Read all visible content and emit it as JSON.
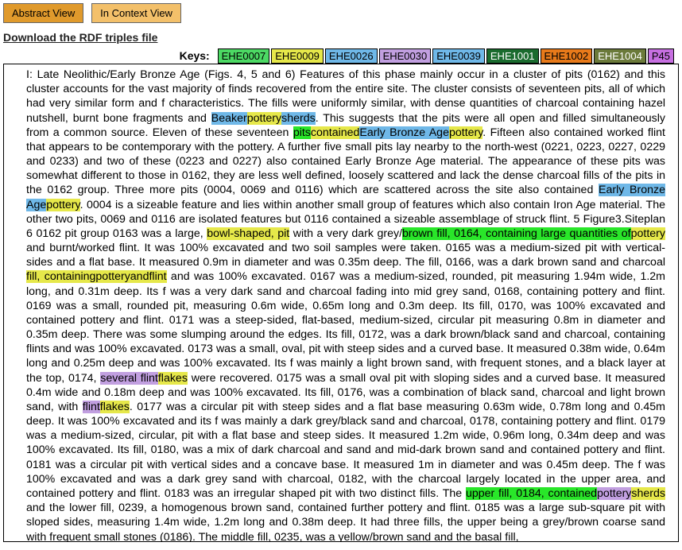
{
  "toolbar": {
    "abstract_btn": "Abstract View",
    "context_btn": "In Context View",
    "download_link": "Download the RDF triples file"
  },
  "keys": {
    "label": "Keys:",
    "items": [
      {
        "code": "EHE0007",
        "cls": "k7"
      },
      {
        "code": "EHE0009",
        "cls": "k9"
      },
      {
        "code": "EHE0026",
        "cls": "k26"
      },
      {
        "code": "EHE0030",
        "cls": "k30"
      },
      {
        "code": "EHE0039",
        "cls": "k39"
      },
      {
        "code": "EHE1001",
        "cls": "k1001"
      },
      {
        "code": "EHE1002",
        "cls": "k1002"
      },
      {
        "code": "EHE1004",
        "cls": "k1004"
      },
      {
        "code": "P45",
        "cls": "k45"
      }
    ]
  },
  "doc": {
    "t01": "I: Late Neolithic/Early Bronze Age (Figs. 4, 5 and 6) Features of this phase mainly occur in a cluster of pits (0162) and this cluster accounts for the vast majority of finds recovered from the entire site. The cluster consists of seventeen pits, all of which had very similar form and f characteristics. The fills were uniformly similar, with dense quantities of charcoal containing hazel nutshell, burnt bone fragments and ",
    "h01a": "Beaker",
    "h01b": "pottery",
    "h01c": "sherds",
    "t02": ". This suggests that the pits were all open and filled simultaneously from a common source. Eleven of these seventeen ",
    "h02a": "pits",
    "h02b": "contained",
    "h02c": "Early Bronze Age",
    "h02d": "pottery",
    "t03": ". Fifteen also contained worked flint that appears to be contemporary with the pottery. A further five small pits lay nearby to the north-west (0221, 0223, 0227, 0229 and 0233) and two of these (0223 and 0227) also contained Early Bronze Age material. The appearance of these pits was somewhat different to those in 0162, they are less well defined, loosely scattered and lack the dense charcoal fills of the pits in the 0162 group. Three more pits (0004, 0069 and 0116) which are scattered across the site also contained ",
    "h03a": "Early Bronze Age",
    "h03b": "pottery",
    "t04": ". 0004 is a sizeable feature and lies within another small group of features which also contain Iron Age material. The other two pits, 0069 and 0116 are isolated features but 0116 contained a sizeable assemblage of struck flint. 5 Figure3.Siteplan 6 0162 pit group 0163 was a large, ",
    "h04a": "bowl-shaped, pit",
    "t05": " with a very dark grey/",
    "h05a": "brown fill, 0164, containing large quantities of",
    "h05b": "pottery",
    "t06": " and burnt/worked flint. It was 100% excavated and two soil samples were taken. 0165 was a medium-sized pit with vertical-sides and a flat base. It measured 0.9m in diameter and was 0.35m deep. The fill, 0166, was a dark brown sand and charcoal ",
    "h06a": "fill, containing",
    "h06b": "pottery",
    "h06c": "and",
    "h06d": "flint",
    "t07": " and was 100% excavated. 0167 was a medium-sized, rounded, pit measuring 1.94m wide, 1.2m long, and 0.31m deep. Its f was a very dark sand and charcoal fading into mid grey sand, 0168, containing pottery and flint. 0169 was a small, rounded pit, measuring 0.6m wide, 0.65m long and 0.3m deep. Its fill, 0170, was 100% excavated and contained pottery and flint. 0171 was a steep-sided, flat-based, medium-sized, circular pit measuring 0.8m in diameter and 0.35m deep. There was some slumping around the edges. Its fill, 0172, was a dark brown/black sand and charcoal, containing flints and was 100% excavated. 0173 was a small, oval, pit with steep sides and a curved base. It measured 0.38m wide, 0.64m long and 0.25m deep and was 100% excavated. Its f was mainly a light brown sand, with frequent stones, and a black layer at the top, 0174, ",
    "h07a": "several flint",
    "h07b": "flakes",
    "t08": " were recovered. 0175 was a small oval pit with sloping sides and a curved base. It measured 0.4m wide and 0.18m deep and was 100% excavated. Its fill, 0176, was a combination of black sand, charcoal and light brown sand, with ",
    "h08a": "flint",
    "h08b": "flakes",
    "t09": ". 0177 was a circular pit with steep sides and a flat base measuring 0.63m wide, 0.78m long and 0.45m deep. It was 100% excavated and its f was mainly a dark grey/black sand and charcoal, 0178, containing pottery and flint. 0179 was a medium-sized, circular, pit with a flat base and steep sides. It measured 1.2m wide, 0.96m long, 0.34m deep and was 100% excavated. Its fill, 0180, was a mix of dark charcoal and sand and mid-dark brown sand and contained pottery and flint. 0181 was a circular pit with vertical sides and a concave base. It measured 1m in diameter and was 0.45m deep. The f was 100% excavated and was a dark grey sand with charcoal, 0182, with the charcoal largely located in the upper area, and contained pottery and flint. 0183 was an irregular shaped pit with two distinct fills. The ",
    "h09a": "upper fill, 0184, contained",
    "h09b": "pottery",
    "h09c": "sherds",
    "t10": " and the lower fill, 0239, a homogenous brown sand, contained further pottery and flint. 0185 was a large sub-square pit with sloped sides, measuring 1.4m wide, 1.2m long and 0.38m deep. It had three fills, the upper being a grey/brown coarse sand with frequent small stones (0186). The middle fill, 0235, was a yellow/brown sand and the basal fill,"
  }
}
